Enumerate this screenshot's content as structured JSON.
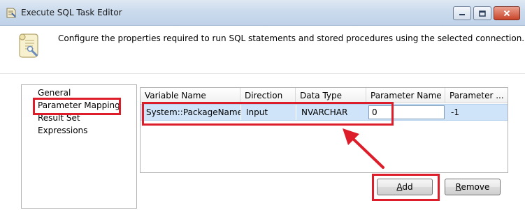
{
  "window": {
    "title": "Execute SQL Task Editor"
  },
  "header": {
    "description": "Configure the properties required to run SQL statements and stored procedures using the selected connection."
  },
  "nav": {
    "items": [
      {
        "label": "General"
      },
      {
        "label": "Parameter Mapping"
      },
      {
        "label": "Result Set"
      },
      {
        "label": "Expressions"
      }
    ],
    "selected": "Parameter Mapping"
  },
  "grid": {
    "columns": [
      {
        "label": "Variable Name"
      },
      {
        "label": "Direction"
      },
      {
        "label": "Data Type"
      },
      {
        "label": "Parameter Name"
      },
      {
        "label": "Parameter ..."
      }
    ],
    "rows": [
      {
        "variable_name": "System::PackageName",
        "direction": "Input",
        "data_type": "NVARCHAR",
        "parameter_name": "0",
        "parameter_size": "-1"
      }
    ]
  },
  "buttons": {
    "add_mnemonic": "A",
    "add_rest": "dd",
    "remove_mnemonic": "R",
    "remove_rest": "emove"
  },
  "colors": {
    "annotation": "#dd1d2a",
    "selected_row": "#cfe4f8"
  },
  "icons": {
    "app": "package-task-icon",
    "header": "scroll-task-icon"
  }
}
